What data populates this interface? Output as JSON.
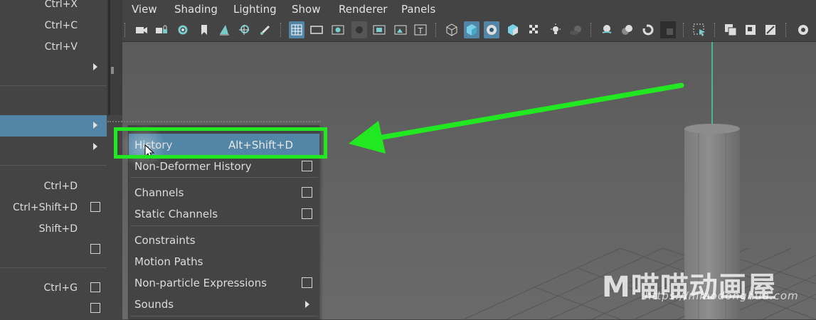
{
  "colors": {
    "highlight": "#5285a6",
    "annotation_green": "#22e822",
    "panel_bg": "#444444",
    "viewport_bg": "#626262"
  },
  "edit_menu": {
    "shortcuts": {
      "cut": "Ctrl+X",
      "copy": "Ctrl+C",
      "paste": "Ctrl+V",
      "duplicate": "Ctrl+D",
      "duplicate_special": "Ctrl+Shift+D",
      "duplicate_with_transform": "Shift+D",
      "group": "Ctrl+G"
    }
  },
  "viewport_menu": {
    "items": [
      "View",
      "Shading",
      "Lighting",
      "Show",
      "Renderer",
      "Panels"
    ]
  },
  "toolbar_icons": [
    "camera-icon",
    "camera-lock-icon",
    "camera-attributes-icon",
    "bookmark-icon",
    "image-plane-icon",
    "2d-pan-zoom-icon",
    "grease-pencil-icon",
    "grid-icon",
    "film-gate-icon",
    "resolution-gate-icon",
    "gate-mask-icon",
    "field-chart-icon",
    "safe-action-icon",
    "safe-title-icon",
    "wireframe-icon",
    "smooth-shade-icon",
    "wireframe-on-shaded-icon",
    "textured-icon",
    "use-all-lights-icon",
    "shadows-icon",
    "ambient-occlusion-icon",
    "motion-blur-icon",
    "anti-aliasing-icon",
    "depth-of-field-icon",
    "isolate-select-icon",
    "xray-icon",
    "xray-joints-icon",
    "xray-components-icon",
    "settings-icon"
  ],
  "delete_by_type_submenu": {
    "items": [
      {
        "label": "History",
        "shortcut": "Alt+Shift+D"
      },
      {
        "label": "Non-Deformer History"
      },
      {
        "label": "Channels"
      },
      {
        "label": "Static Channels"
      },
      {
        "label": "Constraints"
      },
      {
        "label": "Motion Paths"
      },
      {
        "label": "Non-particle Expressions"
      },
      {
        "label": "Sounds"
      }
    ]
  },
  "watermark": {
    "main": "M喵喵动画屋",
    "url": "https://miaodonghua.com"
  }
}
